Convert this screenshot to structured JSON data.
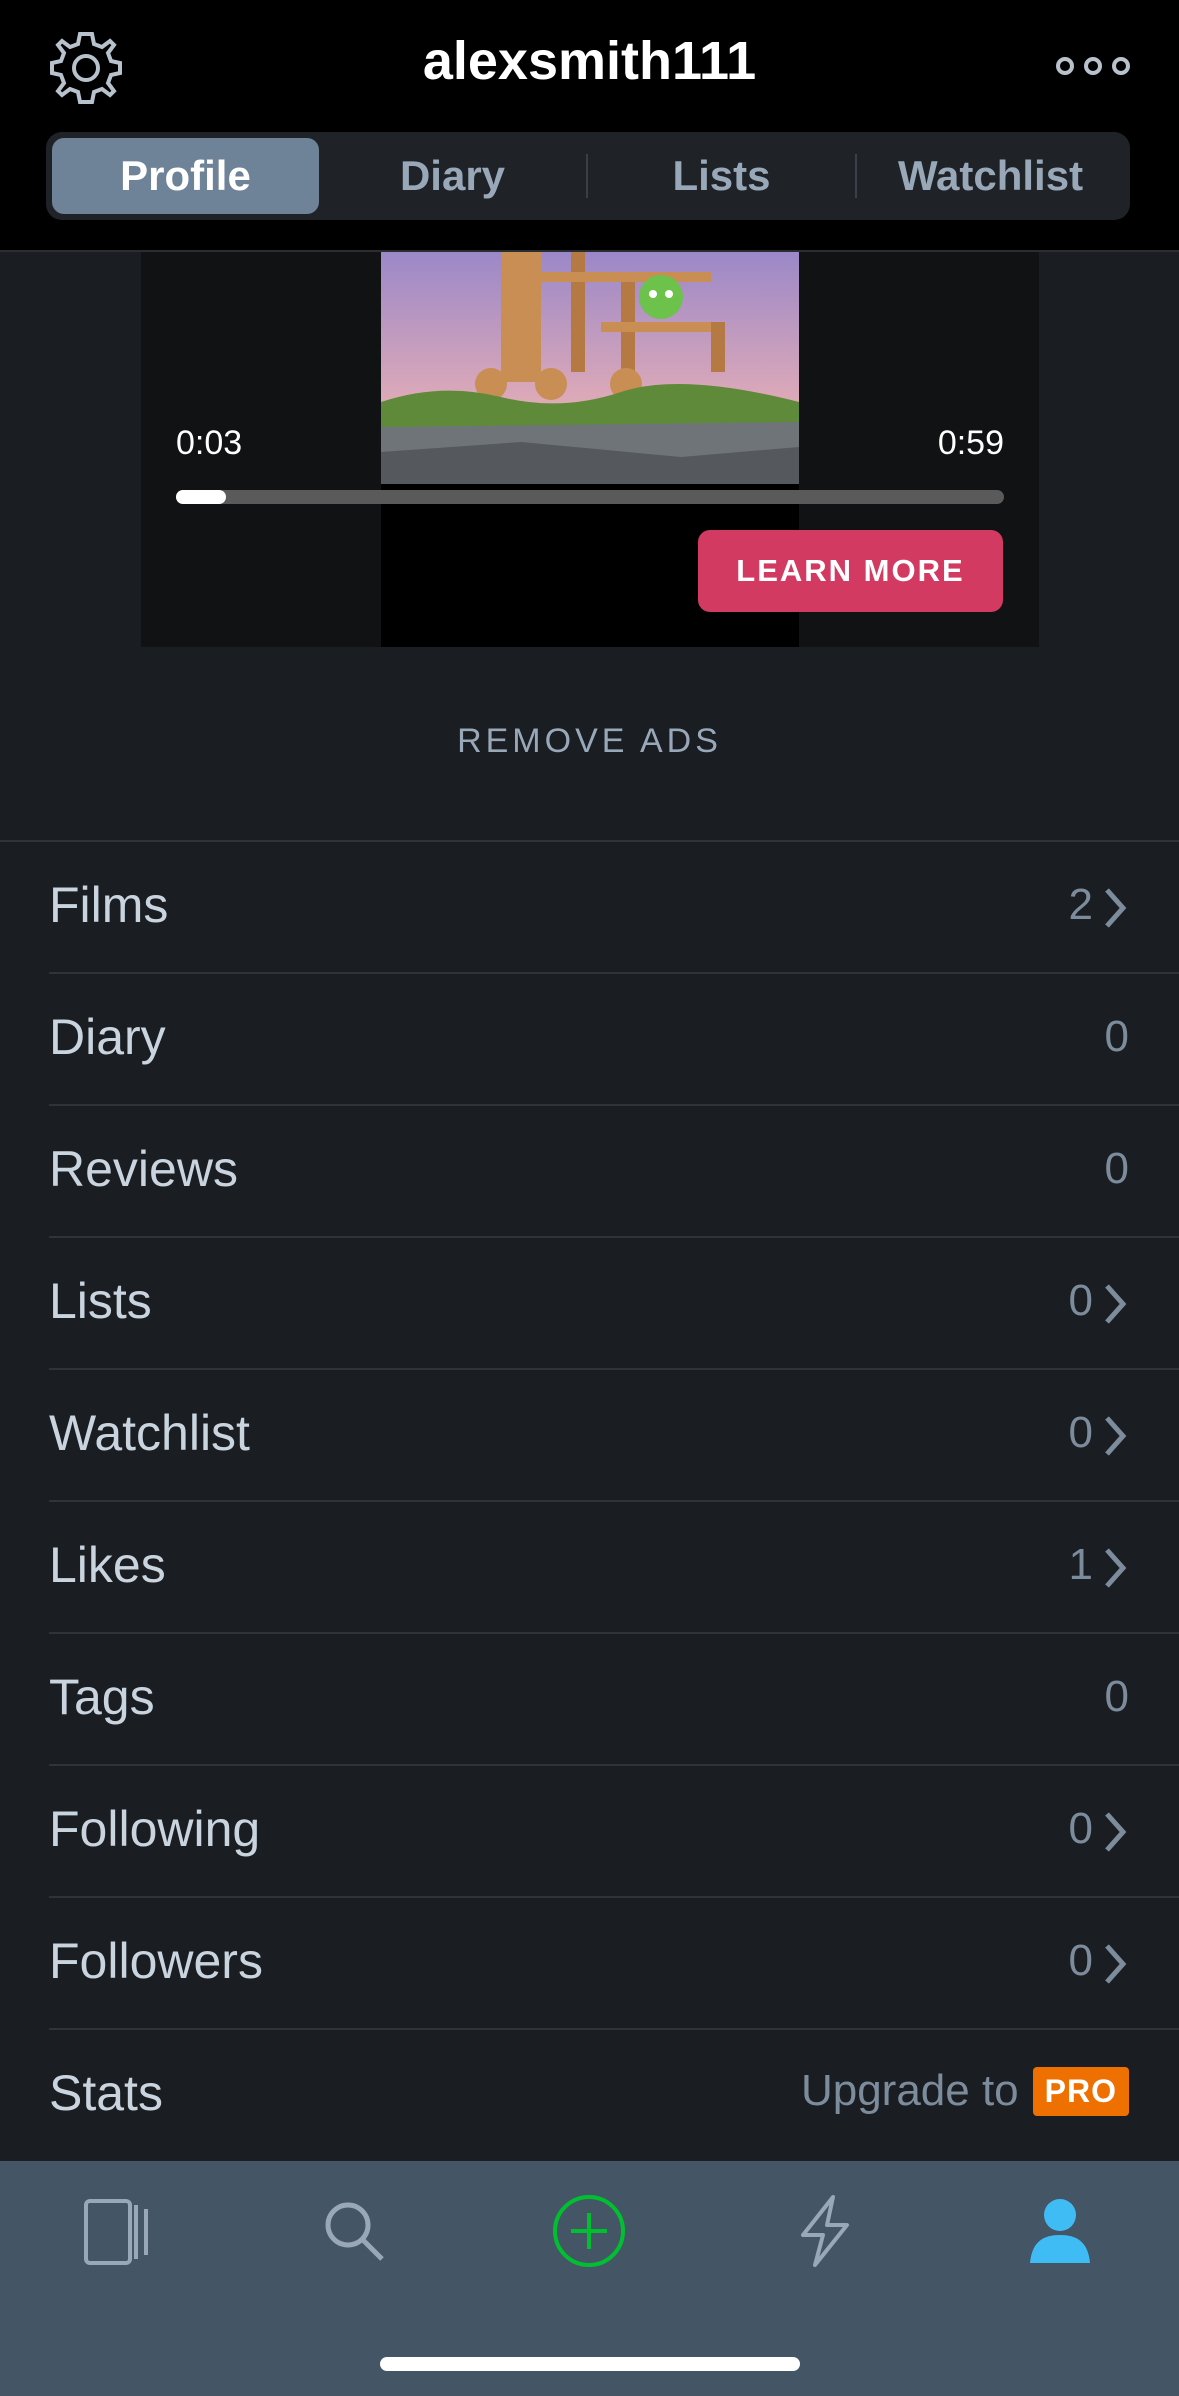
{
  "header": {
    "username": "alexsmith111",
    "tabs": [
      {
        "label": "Profile",
        "active": true
      },
      {
        "label": "Diary",
        "active": false
      },
      {
        "label": "Lists",
        "active": false
      },
      {
        "label": "Watchlist",
        "active": false
      }
    ],
    "icons": {
      "settings": "gear-icon",
      "more": "more-dots-icon"
    }
  },
  "ad": {
    "elapsed": "0:03",
    "duration": "0:59",
    "progress_fraction": 0.06,
    "cta_label": "LEARN MORE"
  },
  "remove_ads_label": "REMOVE ADS",
  "rows": [
    {
      "label": "Films",
      "count": "2",
      "chevron": true
    },
    {
      "label": "Diary",
      "count": "0",
      "chevron": false
    },
    {
      "label": "Reviews",
      "count": "0",
      "chevron": false
    },
    {
      "label": "Lists",
      "count": "0",
      "chevron": true
    },
    {
      "label": "Watchlist",
      "count": "0",
      "chevron": true
    },
    {
      "label": "Likes",
      "count": "1",
      "chevron": true
    },
    {
      "label": "Tags",
      "count": "0",
      "chevron": false
    },
    {
      "label": "Following",
      "count": "0",
      "chevron": true
    },
    {
      "label": "Followers",
      "count": "0",
      "chevron": true
    }
  ],
  "stats": {
    "label": "Stats",
    "upgrade_text": "Upgrade to",
    "badge": "PRO"
  },
  "tabbar": {
    "items": [
      "films-icon",
      "search-icon",
      "add-icon",
      "activity-icon",
      "profile-icon"
    ],
    "active": "profile-icon",
    "colors": {
      "add": "#00c030",
      "active": "#40bcf4",
      "inactive": "#99a8b8"
    }
  }
}
